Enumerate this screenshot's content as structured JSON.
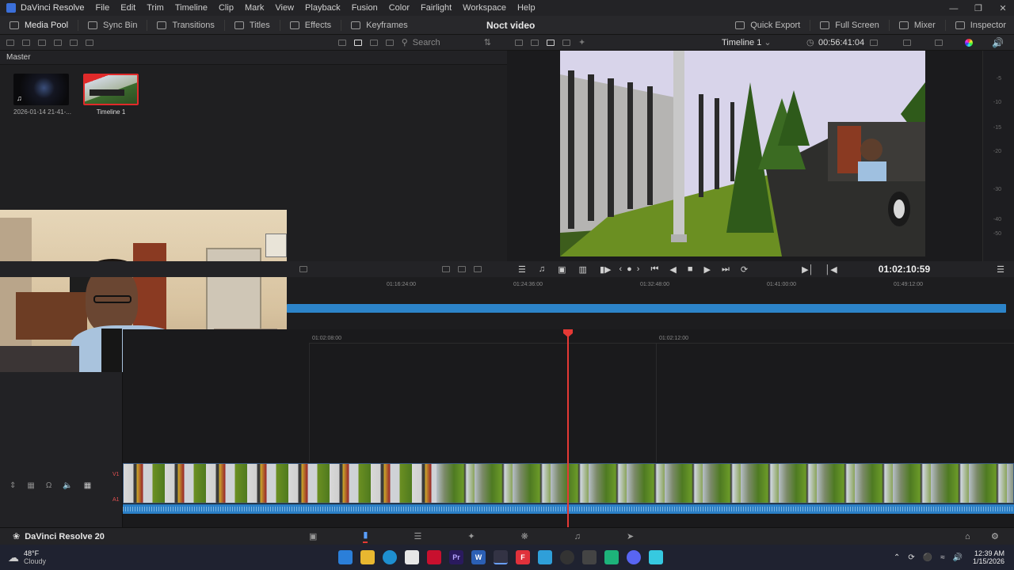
{
  "titlebar": {
    "app_name": "DaVinci Resolve",
    "menu": [
      "File",
      "Edit",
      "Trim",
      "Timeline",
      "Clip",
      "Mark",
      "View",
      "Playback",
      "Fusion",
      "Color",
      "Fairlight",
      "Workspace",
      "Help"
    ],
    "window_controls": [
      "minimize-icon",
      "restore-icon",
      "close-icon"
    ]
  },
  "toolbar": {
    "left": [
      {
        "label": "Media Pool",
        "icon": "media-pool-icon"
      },
      {
        "label": "Sync Bin",
        "icon": "sync-bin-icon"
      },
      {
        "label": "Transitions",
        "icon": "transitions-icon"
      },
      {
        "label": "Titles",
        "icon": "titles-icon"
      },
      {
        "label": "Effects",
        "icon": "effects-icon"
      },
      {
        "label": "Keyframes",
        "icon": "keyframes-icon"
      }
    ],
    "project_title": "Noct video",
    "right": [
      {
        "label": "Quick Export",
        "icon": "quick-export-icon"
      },
      {
        "label": "Full Screen",
        "icon": "full-screen-icon"
      },
      {
        "label": "Mixer",
        "icon": "mixer-icon"
      },
      {
        "label": "Inspector",
        "icon": "inspector-icon"
      }
    ]
  },
  "media_pool": {
    "search_placeholder": "Search",
    "bin_name": "Master",
    "clips": [
      {
        "name": "2026-01-14 21-41-...",
        "type": "audio-video"
      },
      {
        "name": "Timeline 1",
        "type": "timeline"
      }
    ]
  },
  "viewer": {
    "timeline_name": "Timeline 1",
    "duration": "00:56:41:04",
    "current_timecode": "01:02:10:59",
    "meter_scale": [
      "-5",
      "-10",
      "-15",
      "-20",
      "-30",
      "-40",
      "-50"
    ]
  },
  "timeline": {
    "upper_ruler": [
      "01:16:24:00",
      "01:24:36:00",
      "01:32:48:00",
      "01:41:00:00",
      "01:49:12:00"
    ],
    "lower_ruler": [
      "01:02:08:00",
      "01:02:12:00"
    ],
    "tracks": {
      "video": "V1",
      "audio": "A1"
    }
  },
  "page_nav": {
    "brand": "DaVinci Resolve 20",
    "pages": [
      "media-page-icon",
      "cut-page-icon",
      "edit-page-icon",
      "fusion-page-icon",
      "color-page-icon",
      "fairlight-page-icon",
      "deliver-page-icon"
    ],
    "active_index": 1
  },
  "taskbar": {
    "weather_temp": "48°F",
    "weather_desc": "Cloudy",
    "time": "12:39 AM",
    "date": "1/15/2026",
    "apps": [
      "start-icon",
      "file-explorer-icon",
      "edge-icon",
      "store-icon",
      "mcafee-icon",
      "premiere-icon",
      "word-icon",
      "resolve-icon",
      "tf-icon",
      "notepad-icon",
      "obs-icon",
      "calculator-icon",
      "app-icon",
      "discord-icon",
      "notes-icon"
    ]
  },
  "colors": {
    "accent_blue": "#2c84c9",
    "playhead_red": "#e53935",
    "panel_bg": "#1f1f21"
  }
}
